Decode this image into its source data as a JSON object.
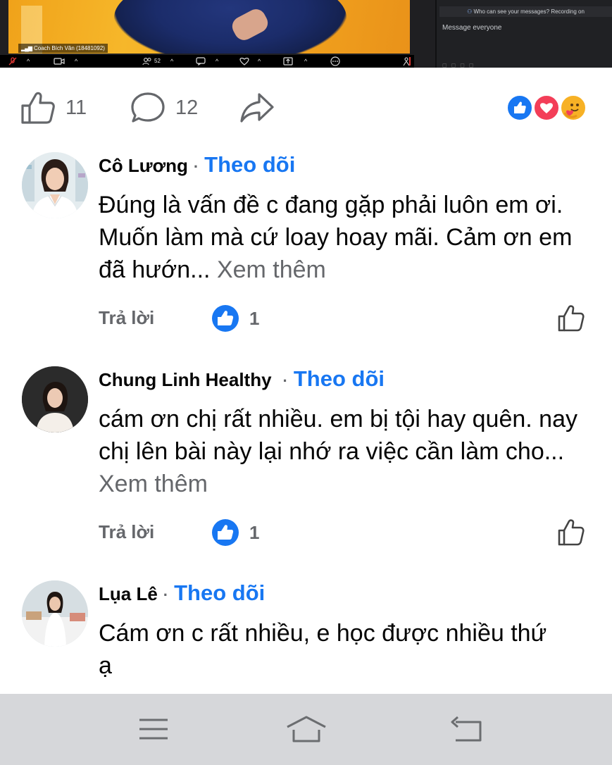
{
  "video": {
    "caption": "Coach Bích Vân (18481092)",
    "toolbar": {
      "participants_count": "52"
    },
    "chat": {
      "who_can_see": "Who can see your messages? Recording on",
      "input_placeholder": "Message everyone"
    }
  },
  "post_actions": {
    "like_count": "11",
    "comment_count": "12",
    "reactions": [
      "like-reaction",
      "love-reaction",
      "care-reaction"
    ],
    "colors": {
      "like": "#1877f2",
      "love": "#f33e58",
      "care": "#f7b125"
    }
  },
  "comments": [
    {
      "name": "Cô Lương",
      "separator": "·",
      "follow": "Theo dõi",
      "text": "Đúng là vấn đề c đang gặp phải luôn em ơi. Muốn làm mà cứ loay hoay mãi. Cảm ơn em đã hướn...",
      "see_more": "Xem thêm",
      "reply": "Trả lời",
      "likes": "1"
    },
    {
      "name": "Chung Linh Healthy",
      "separator": "·",
      "follow": "Theo dõi",
      "text": "cám ơn chị rất nhiều. em bị tội hay quên. nay chị lên bài này lại nhớ ra việc cần làm cho...",
      "see_more": "Xem thêm",
      "reply": "Trả lời",
      "likes": "1"
    },
    {
      "name": "Lụa Lê",
      "separator": "·",
      "follow": "Theo dõi",
      "text": "Cám ơn c rất nhiều, e học được nhiều thứ ạ"
    }
  ],
  "system_nav": {
    "icons": [
      "recent-apps-icon",
      "home-icon",
      "back-icon"
    ],
    "background": "#d6d7da"
  }
}
